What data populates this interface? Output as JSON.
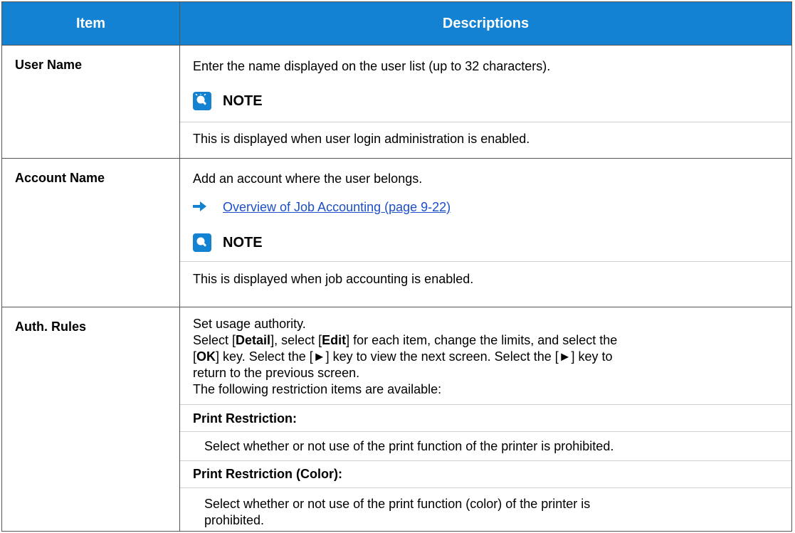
{
  "table": {
    "header": {
      "item": "Item",
      "descriptions": "Descriptions"
    },
    "rows": {
      "user_name": {
        "item": "User Name",
        "text": "Enter the name displayed on the user list (up to 32 characters).",
        "note_label": "NOTE",
        "note_text": "This is displayed when user login administration is enabled."
      },
      "account_name": {
        "item": "Account Name",
        "text": "Add an account where the user belongs.",
        "link_text": "Overview of Job Accounting (page 9-22)",
        "note_label": "NOTE",
        "note_text": "This is displayed when job accounting is enabled."
      },
      "auth_rules": {
        "item": "Auth. Rules",
        "line1": "Set usage authority.",
        "l2_a": "Select [",
        "l2_detail": "Detail",
        "l2_b": "], select [",
        "l2_edit": "Edit",
        "l2_c": "] for each item, change the limits, and select the",
        "l3_a": "[",
        "l3_ok": "OK",
        "l3_b": "] key. Select the [►] key to view the next screen. Select the [►] key to",
        "line4": "return to the previous screen.",
        "line5": "The following restriction items are available:",
        "print_restriction_head": "Print Restriction:",
        "print_restriction_text": "Select whether or not use of the print function of the printer is prohibited.",
        "print_restriction_color_head": "Print Restriction (Color):",
        "print_restriction_color_text_1": "Select whether or not use of the print function (color) of the printer is",
        "print_restriction_color_text_2": "prohibited."
      }
    }
  },
  "icons": {
    "note": "note-lightbulb-icon",
    "link_arrow": "right-arrow-icon"
  },
  "colors": {
    "header_bg": "#1382d3",
    "link": "#1c4fc9",
    "icon": "#1382d3"
  }
}
